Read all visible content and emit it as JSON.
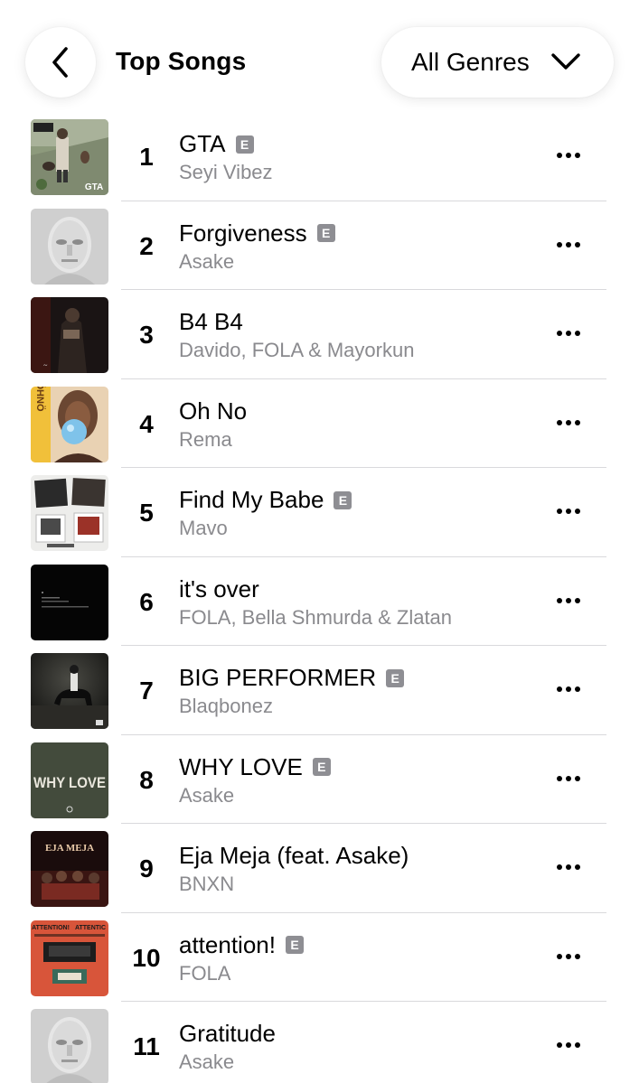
{
  "header": {
    "title": "Top Songs",
    "genre_label": "All Genres",
    "back_icon": "chevron-left-icon",
    "genre_icon": "chevron-down-icon"
  },
  "songs": [
    {
      "rank": "1",
      "title": "GTA",
      "artist": "Seyi Vibez",
      "explicit": true
    },
    {
      "rank": "2",
      "title": "Forgiveness",
      "artist": "Asake",
      "explicit": true
    },
    {
      "rank": "3",
      "title": "B4 B4",
      "artist": "Davido, FOLA & Mayorkun",
      "explicit": false
    },
    {
      "rank": "4",
      "title": "Oh No",
      "artist": "Rema",
      "explicit": false
    },
    {
      "rank": "5",
      "title": "Find My Babe",
      "artist": "Mavo",
      "explicit": true
    },
    {
      "rank": "6",
      "title": "it's over",
      "artist": "FOLA, Bella Shmurda & Zlatan",
      "explicit": false
    },
    {
      "rank": "7",
      "title": "BIG PERFORMER",
      "artist": "Blaqbonez",
      "explicit": true
    },
    {
      "rank": "8",
      "title": "WHY LOVE",
      "artist": "Asake",
      "explicit": true
    },
    {
      "rank": "9",
      "title": "Eja Meja (feat. Asake)",
      "artist": "BNXN",
      "explicit": false
    },
    {
      "rank": "10",
      "title": "attention!",
      "artist": "FOLA",
      "explicit": true
    },
    {
      "rank": "11",
      "title": "Gratitude",
      "artist": "Asake",
      "explicit": false
    }
  ],
  "badges": {
    "explicit": "E"
  },
  "artwork": {
    "gta": "GTA",
    "why_love": "WHY LOVE",
    "eja_meja": "EJA MEJA",
    "oh_no": "ÖHNÖ",
    "attention": "ATTENTION!"
  }
}
